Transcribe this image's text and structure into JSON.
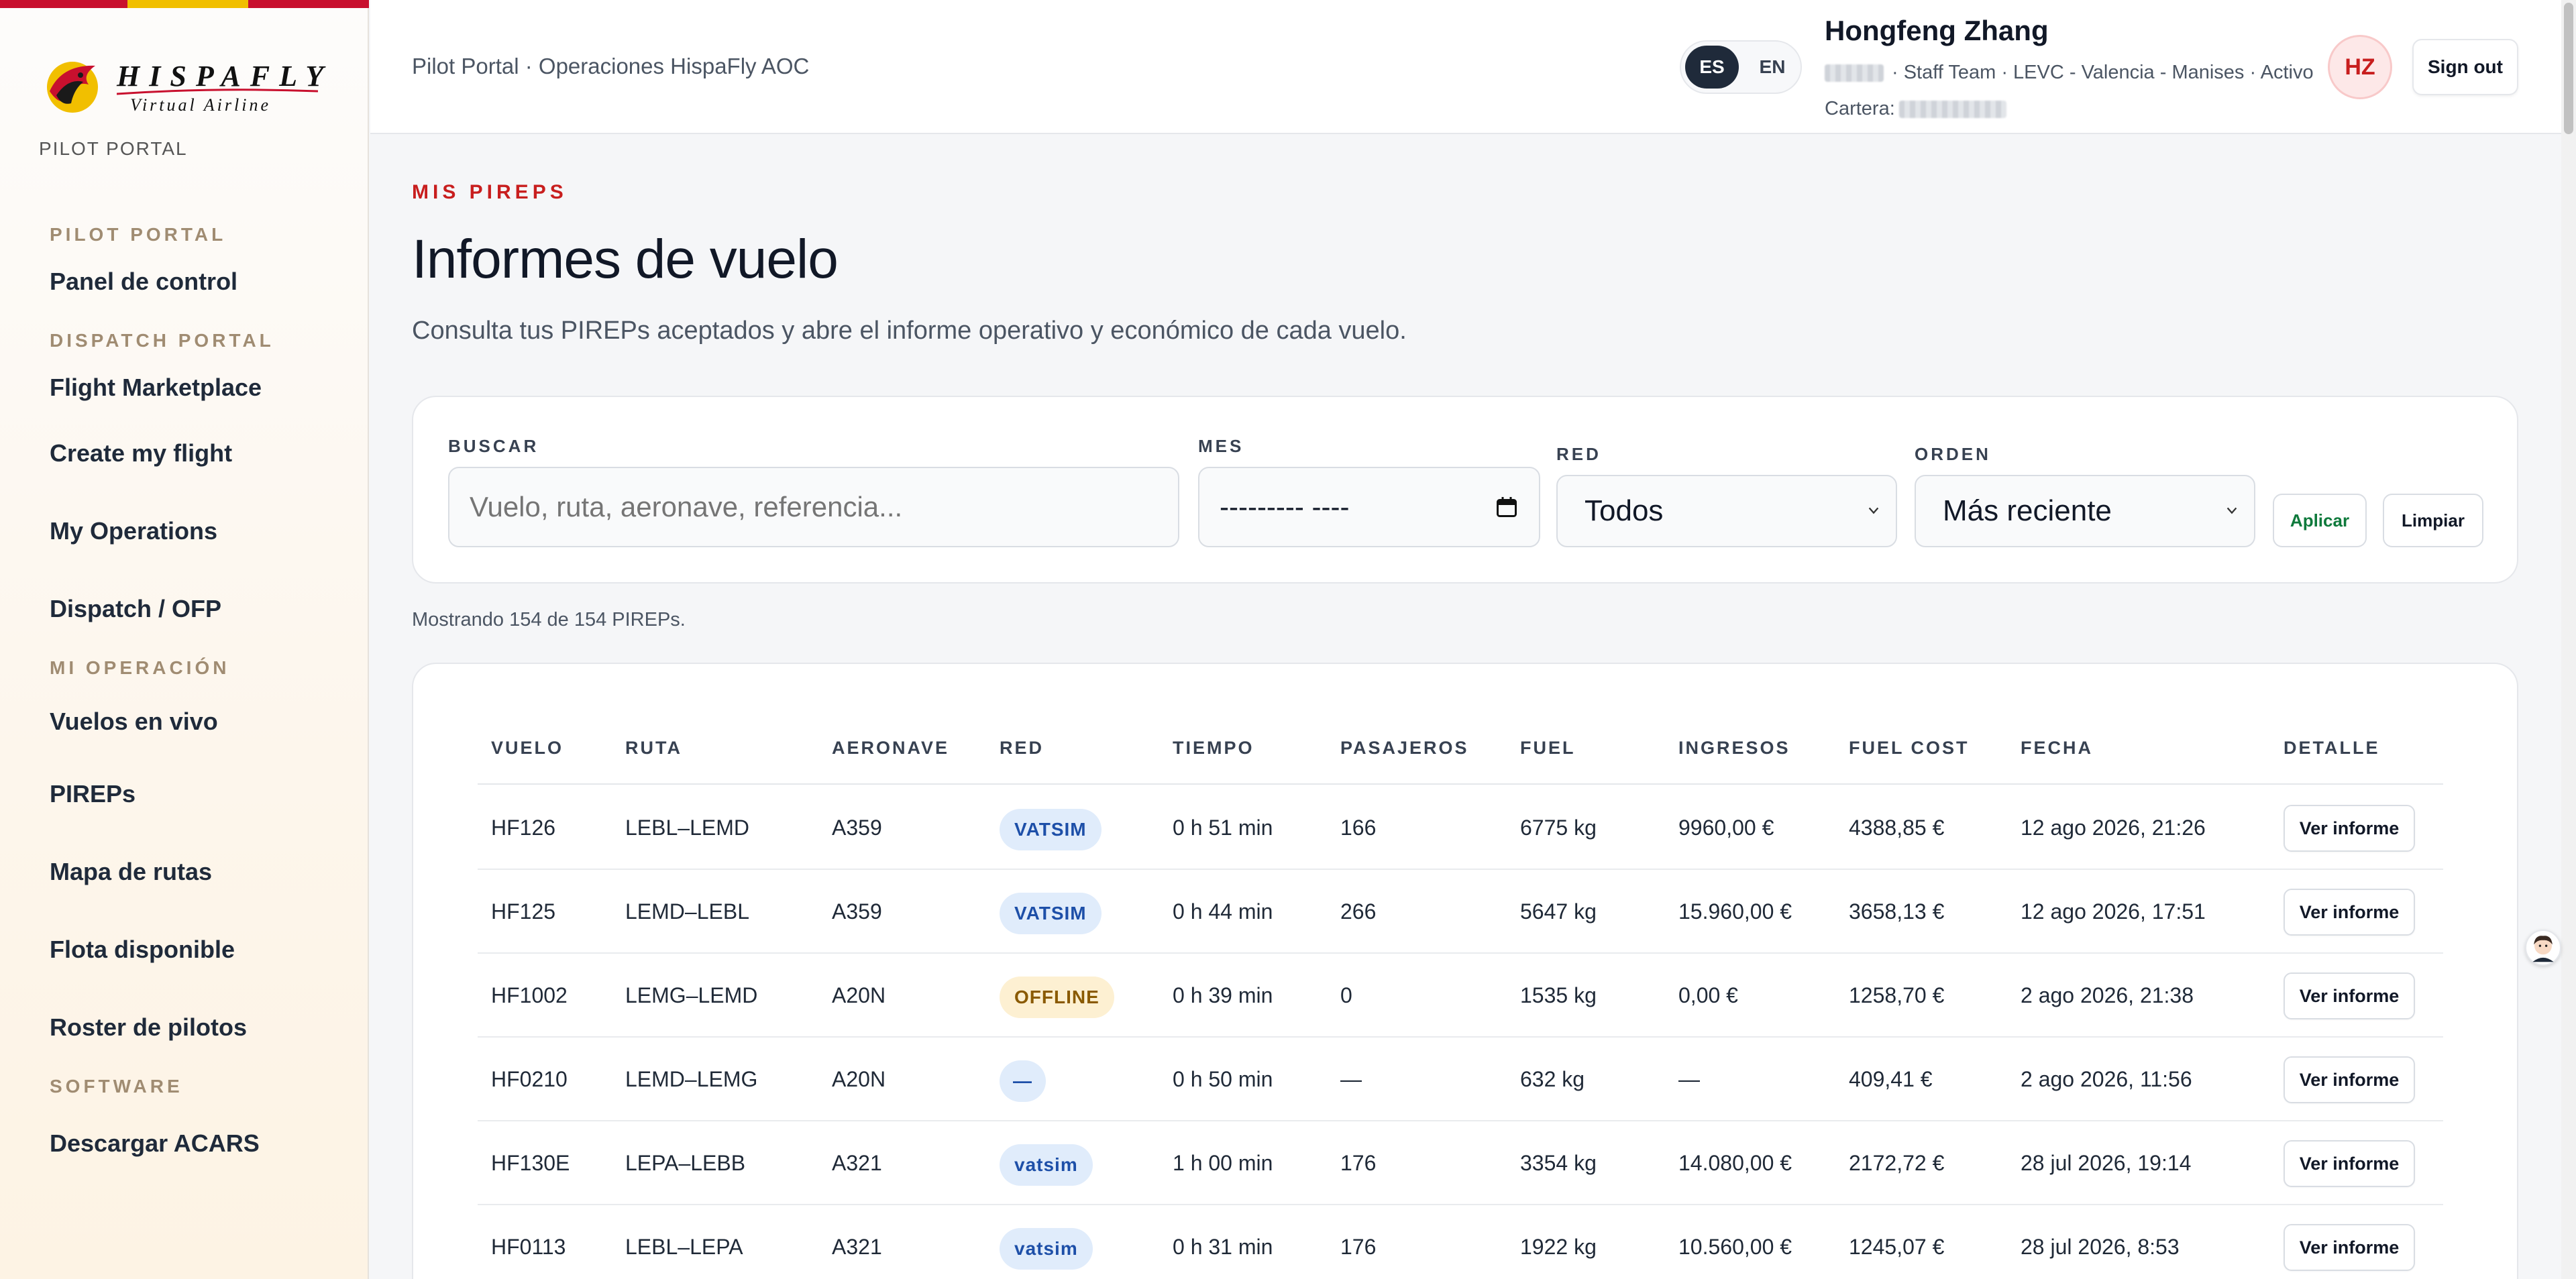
{
  "brand": {
    "logo_name": "HISPAFLY",
    "logo_sub": "Virtual Airline",
    "portal_label": "PILOT PORTAL",
    "colors": {
      "red": "#c8102e",
      "yellow": "#f1bf00",
      "accent_red": "#c81e1e"
    }
  },
  "sidebar": {
    "sections": [
      {
        "title": "PILOT PORTAL",
        "items": [
          "Panel de control"
        ]
      },
      {
        "title": "DISPATCH PORTAL",
        "items": [
          "Flight Marketplace",
          "Create my flight",
          "My Operations",
          "Dispatch / OFP"
        ]
      },
      {
        "title": "MI OPERACIÓN",
        "items": [
          "Vuelos en vivo",
          "PIREPs",
          "Mapa de rutas",
          "Flota disponible",
          "Roster de pilotos"
        ]
      },
      {
        "title": "SOFTWARE",
        "items": [
          "Descargar ACARS"
        ]
      }
    ]
  },
  "header": {
    "breadcrumb": "Pilot Portal · Operaciones HispaFly AOC",
    "lang": {
      "es": "ES",
      "en": "EN",
      "active": "ES"
    },
    "user": {
      "name": "Hongfeng Zhang",
      "meta": "· Staff Team · LEVC - Valencia - Manises · Activo",
      "wallet_label": "Cartera:",
      "initials": "HZ"
    },
    "signout": "Sign out"
  },
  "page": {
    "eyebrow": "MIS PIREPS",
    "title": "Informes de vuelo",
    "description": "Consulta tus PIREPs aceptados y abre el informe operativo y económico de cada vuelo."
  },
  "filters": {
    "search_label": "BUSCAR",
    "search_placeholder": "Vuelo, ruta, aeronave, referencia...",
    "month_label": "MES",
    "month_value": "--------- ----",
    "network_label": "RED",
    "network_value": "Todos",
    "order_label": "ORDEN",
    "order_value": "Más reciente",
    "apply": "Aplicar",
    "clear": "Limpiar"
  },
  "count_text": "Mostrando 154 de 154 PIREPs.",
  "table": {
    "headers": [
      "VUELO",
      "RUTA",
      "AERONAVE",
      "RED",
      "TIEMPO",
      "PASAJEROS",
      "FUEL",
      "INGRESOS",
      "FUEL COST",
      "FECHA",
      "DETALLE"
    ],
    "view_label": "Ver informe",
    "rows": [
      {
        "flight": "HF126",
        "route": "LEBL–LEMD",
        "aircraft": "A359",
        "network": "VATSIM",
        "network_style": "vatsim",
        "time": "0 h 51 min",
        "pax": "166",
        "fuel": "6775 kg",
        "revenue": "9960,00 €",
        "fuel_cost": "4388,85 €",
        "date": "12 ago 2026, 21:26"
      },
      {
        "flight": "HF125",
        "route": "LEMD–LEBL",
        "aircraft": "A359",
        "network": "VATSIM",
        "network_style": "vatsim",
        "time": "0 h 44 min",
        "pax": "266",
        "fuel": "5647 kg",
        "revenue": "15.960,00 €",
        "fuel_cost": "3658,13 €",
        "date": "12 ago 2026, 17:51"
      },
      {
        "flight": "HF1002",
        "route": "LEMG–LEMD",
        "aircraft": "A20N",
        "network": "OFFLINE",
        "network_style": "offline",
        "time": "0 h 39 min",
        "pax": "0",
        "fuel": "1535 kg",
        "revenue": "0,00 €",
        "fuel_cost": "1258,70 €",
        "date": "2 ago 2026, 21:38"
      },
      {
        "flight": "HF0210",
        "route": "LEMD–LEMG",
        "aircraft": "A20N",
        "network": "—",
        "network_style": "none",
        "time": "0 h 50 min",
        "pax": "—",
        "fuel": "632 kg",
        "revenue": "—",
        "fuel_cost": "409,41 €",
        "date": "2 ago 2026, 11:56"
      },
      {
        "flight": "HF130E",
        "route": "LEPA–LEBB",
        "aircraft": "A321",
        "network": "vatsim",
        "network_style": "vatsim",
        "time": "1 h 00 min",
        "pax": "176",
        "fuel": "3354 kg",
        "revenue": "14.080,00 €",
        "fuel_cost": "2172,72 €",
        "date": "28 jul 2026, 19:14"
      },
      {
        "flight": "HF0113",
        "route": "LEBL–LEPA",
        "aircraft": "A321",
        "network": "vatsim",
        "network_style": "vatsim",
        "time": "0 h 31 min",
        "pax": "176",
        "fuel": "1922 kg",
        "revenue": "10.560,00 €",
        "fuel_cost": "1245,07 €",
        "date": "28 jul 2026, 8:53"
      }
    ]
  }
}
